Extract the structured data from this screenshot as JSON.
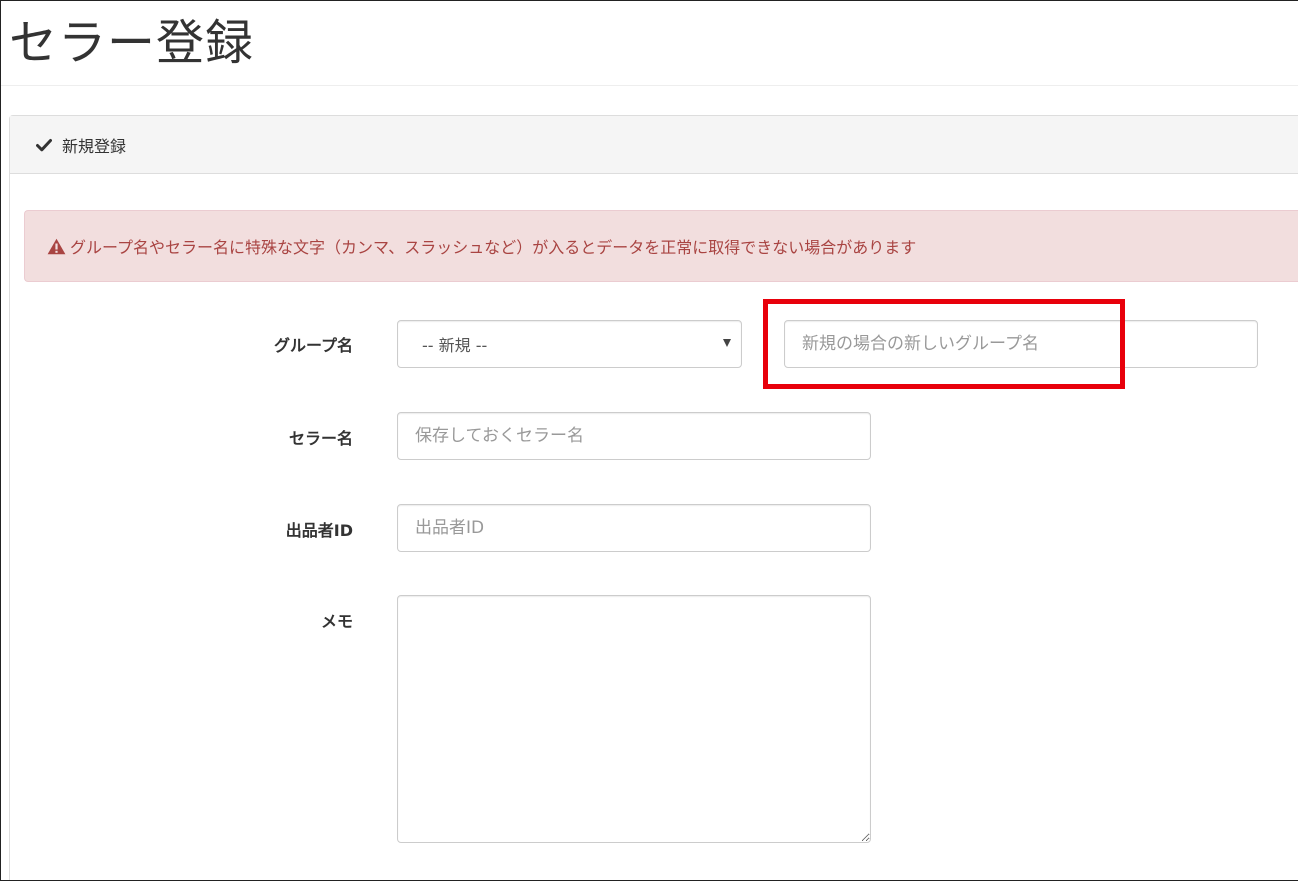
{
  "page": {
    "title": "セラー登録"
  },
  "panel": {
    "heading_icon": "check-icon",
    "heading": "新規登録"
  },
  "alert": {
    "icon": "warning-icon",
    "text": "グループ名やセラー名に特殊な文字（カンマ、スラッシュなど）が入るとデータを正常に取得できない場合があります",
    "color": "#a94442",
    "background": "#f2dede"
  },
  "form": {
    "group": {
      "label": "グループ名",
      "select_value": "-- 新規 --",
      "new_group_placeholder": "新規の場合の新しいグループ名",
      "new_group_value": ""
    },
    "seller_name": {
      "label": "セラー名",
      "placeholder": "保存しておくセラー名",
      "value": ""
    },
    "seller_id": {
      "label": "出品者ID",
      "placeholder": "出品者ID",
      "value": ""
    },
    "memo": {
      "label": "メモ",
      "value": ""
    }
  },
  "annotation": {
    "highlight_color": "#e8000b"
  }
}
